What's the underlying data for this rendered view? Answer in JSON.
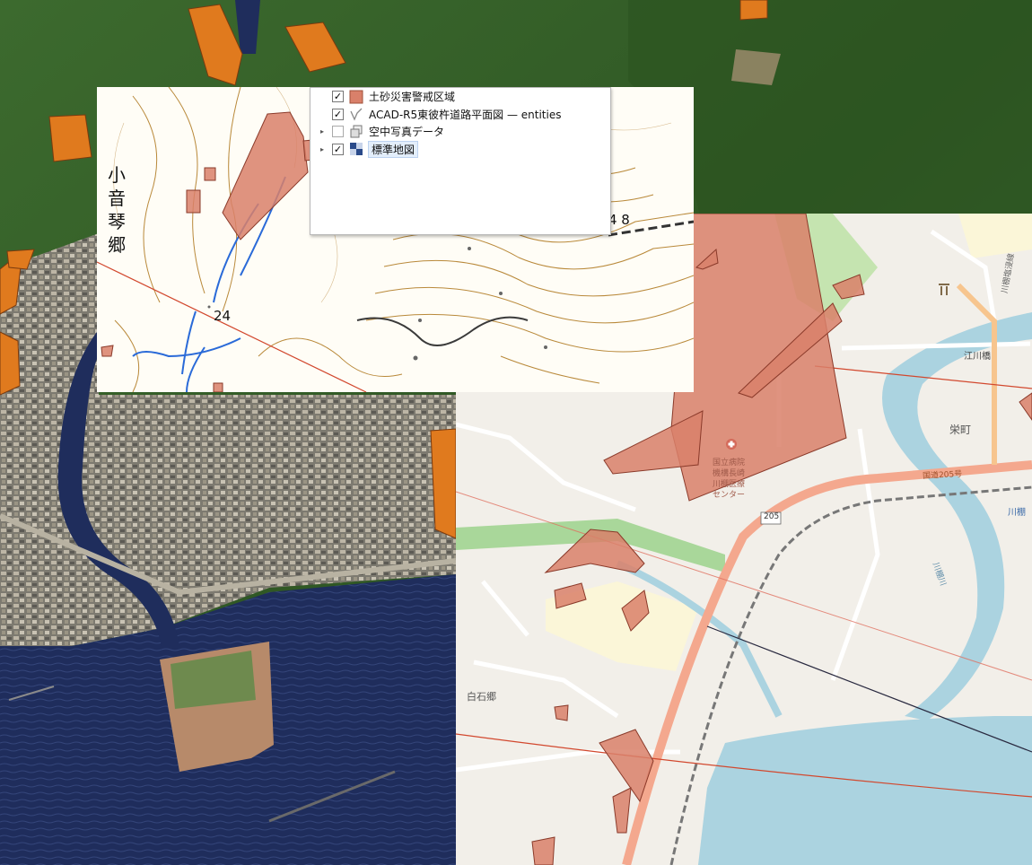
{
  "layers_panel": {
    "items": [
      {
        "label": "土砂災害警戒区域",
        "checked": true,
        "expandable": false,
        "icon": "polygon-fill-icon",
        "color": "#d9806a"
      },
      {
        "label": "ACAD-R5東彼杵道路平面図 — entities",
        "checked": true,
        "expandable": false,
        "icon": "line-layer-icon"
      },
      {
        "label": "空中写真データ",
        "checked": false,
        "expandable": true,
        "icon": "raster-group-icon"
      },
      {
        "label": "標準地図",
        "checked": true,
        "expandable": true,
        "icon": "raster-layer-icon",
        "selected": true
      }
    ]
  },
  "topo_labels": {
    "village_vertical": "小音琴郷",
    "elevation_point": "24",
    "elevation_partial": "4 8"
  },
  "std_map_labels": {
    "sakaemachi": "栄町",
    "shiraishigo": "白石郷",
    "kawatana_station": "川棚",
    "route205_label": "国道205号",
    "route205_shield": "205",
    "bridge": "江川橋",
    "kawatana_river": "川棚川",
    "street": "川棚塩浸線",
    "hospital_line1": "国立病院",
    "hospital_line2": "機構長崎",
    "hospital_line3": "川棚医療",
    "hospital_line4": "センター"
  },
  "colors": {
    "hazard": "#d9806a",
    "hazard_outline": "#8a3a2a",
    "aerial_hazard": "#e07a1e",
    "sea": "#1f2d5c",
    "water": "#abd3e0",
    "road_route": "#f4a88e",
    "contour": "#b9893a",
    "survey_line": "#d2482e"
  }
}
